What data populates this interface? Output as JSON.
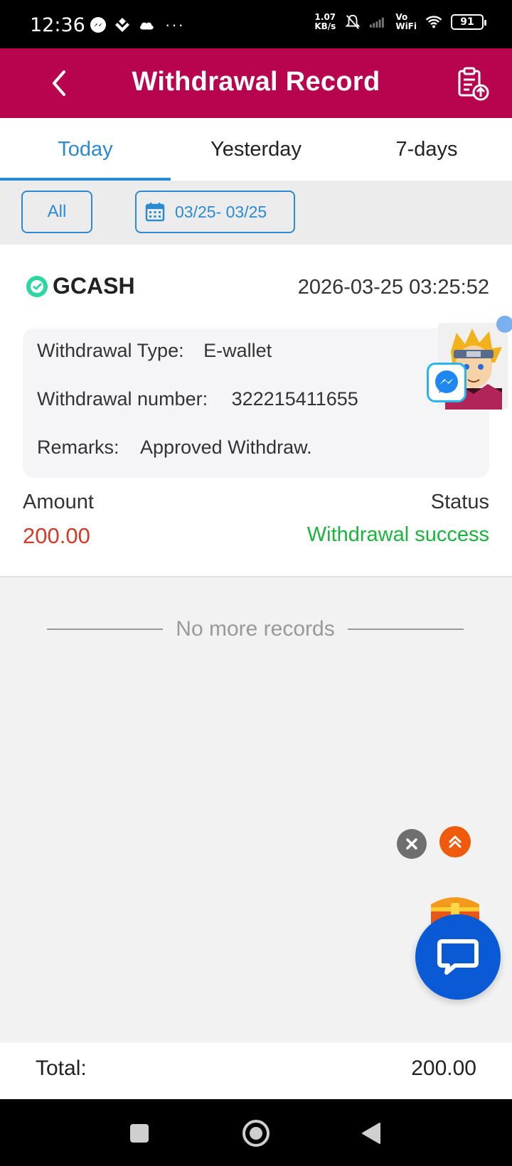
{
  "status_bar": {
    "time": "12:36",
    "speed_value": "1.07",
    "speed_unit": "KB/s",
    "vo": "Vo",
    "wifi": "WiFi",
    "battery": "91"
  },
  "header": {
    "title": "Withdrawal Record",
    "color": "#b8044f"
  },
  "tabs": [
    {
      "label": "Today",
      "active": true
    },
    {
      "label": "Yesterday",
      "active": false
    },
    {
      "label": "7-days",
      "active": false
    }
  ],
  "filters": {
    "all_label": "All",
    "date_range": "03/25- 03/25"
  },
  "record": {
    "method": "GCASH",
    "datetime": "2026-03-25 03:25:52",
    "withdrawal_type_label": "Withdrawal Type:",
    "withdrawal_type": "E-wallet",
    "withdrawal_number_label": "Withdrawal number:",
    "withdrawal_number": "322215411655",
    "remarks_label": "Remarks:",
    "remarks": "Approved Withdraw.",
    "amount_label": "Amount",
    "amount": "200.00",
    "status_label": "Status",
    "status": "Withdrawal success",
    "status_color": "#19b43c",
    "amount_color": "#d23a28"
  },
  "list_end_text": "No more records",
  "footer": {
    "total_label": "Total:",
    "total_value": "200.00"
  },
  "accent_color": "#2b8ad0"
}
